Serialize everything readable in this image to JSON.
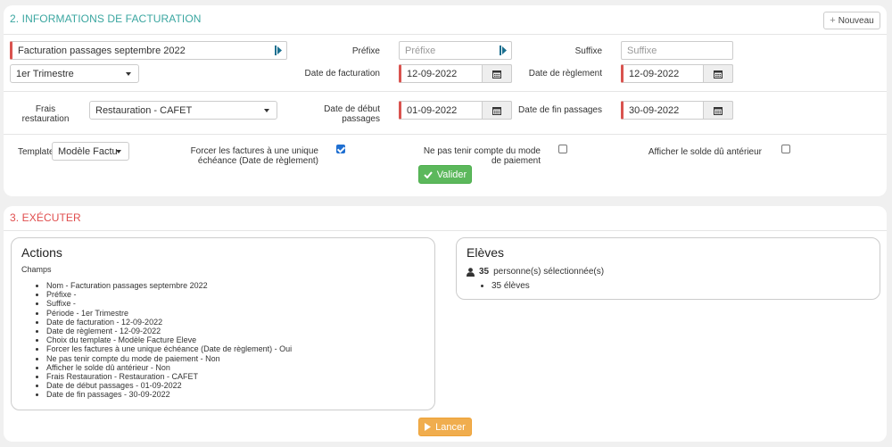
{
  "billing": {
    "title": "2. INFORMATIONS DE FACTURATION",
    "new_button": "Nouveau",
    "name_value": "Facturation passages septembre 2022",
    "prefix_label": "Préfixe",
    "prefix_placeholder": "Préfixe",
    "suffix_label": "Suffixe",
    "suffix_placeholder": "Suffixe",
    "period_value": "1er Trimestre",
    "billing_date_label": "Date de facturation",
    "billing_date_value": "12-09-2022",
    "payment_date_label": "Date de règlement",
    "payment_date_value": "12-09-2022",
    "fees_label": "Frais restauration",
    "fees_value": "Restauration - CAFET",
    "start_label": "Date de début passages",
    "start_value": "01-09-2022",
    "end_label": "Date de fin passages",
    "end_value": "30-09-2022",
    "template_label": "Template",
    "template_value": "Modèle Factu",
    "force_label": "Forcer les factures à une unique échéance (Date de règlement)",
    "force_checked": true,
    "ignore_label": "Ne pas tenir compte du mode de paiement",
    "ignore_checked": false,
    "balance_label": "Afficher le solde dû antérieur",
    "balance_checked": false,
    "validate_button": "Valider"
  },
  "execute": {
    "title": "3. EXÉCUTER",
    "actions_title": "Actions",
    "champs_label": "Champs",
    "actions": [
      "Nom - Facturation passages septembre 2022",
      "Préfixe -",
      "Suffixe -",
      "Période - 1er Trimestre",
      "Date de facturation - 12-09-2022",
      "Date de règlement - 12-09-2022",
      "Choix du template - Modèle Facture Eleve",
      "Forcer les factures à une unique échéance (Date de règlement) - Oui",
      "Ne pas tenir compte du mode de paiement - Non",
      "Afficher le solde dû antérieur - Non",
      "Frais Restauration - Restauration - CAFET",
      "Date de début passages - 01-09-2022",
      "Date de fin passages - 30-09-2022"
    ],
    "students_title": "Elèves",
    "selected_count": "35",
    "selected_text": "personne(s) sélectionnée(s)",
    "students_items": [
      "35 élèves"
    ],
    "launch_button": "Lancer"
  },
  "colors": {
    "billing_title": "#3aa6a0",
    "execute_title": "#e04e4e",
    "required_border": "#d9534f",
    "validate": "#5cb85c",
    "launch": "#f0ad4e",
    "checkbox": "#1f6fd1"
  },
  "icons": {
    "sideicon": "sidebar-toggle-icon",
    "calendar": "calendar-icon",
    "user": "user-icon",
    "check": "check-icon",
    "play": "play-icon",
    "plus": "plus-icon"
  }
}
